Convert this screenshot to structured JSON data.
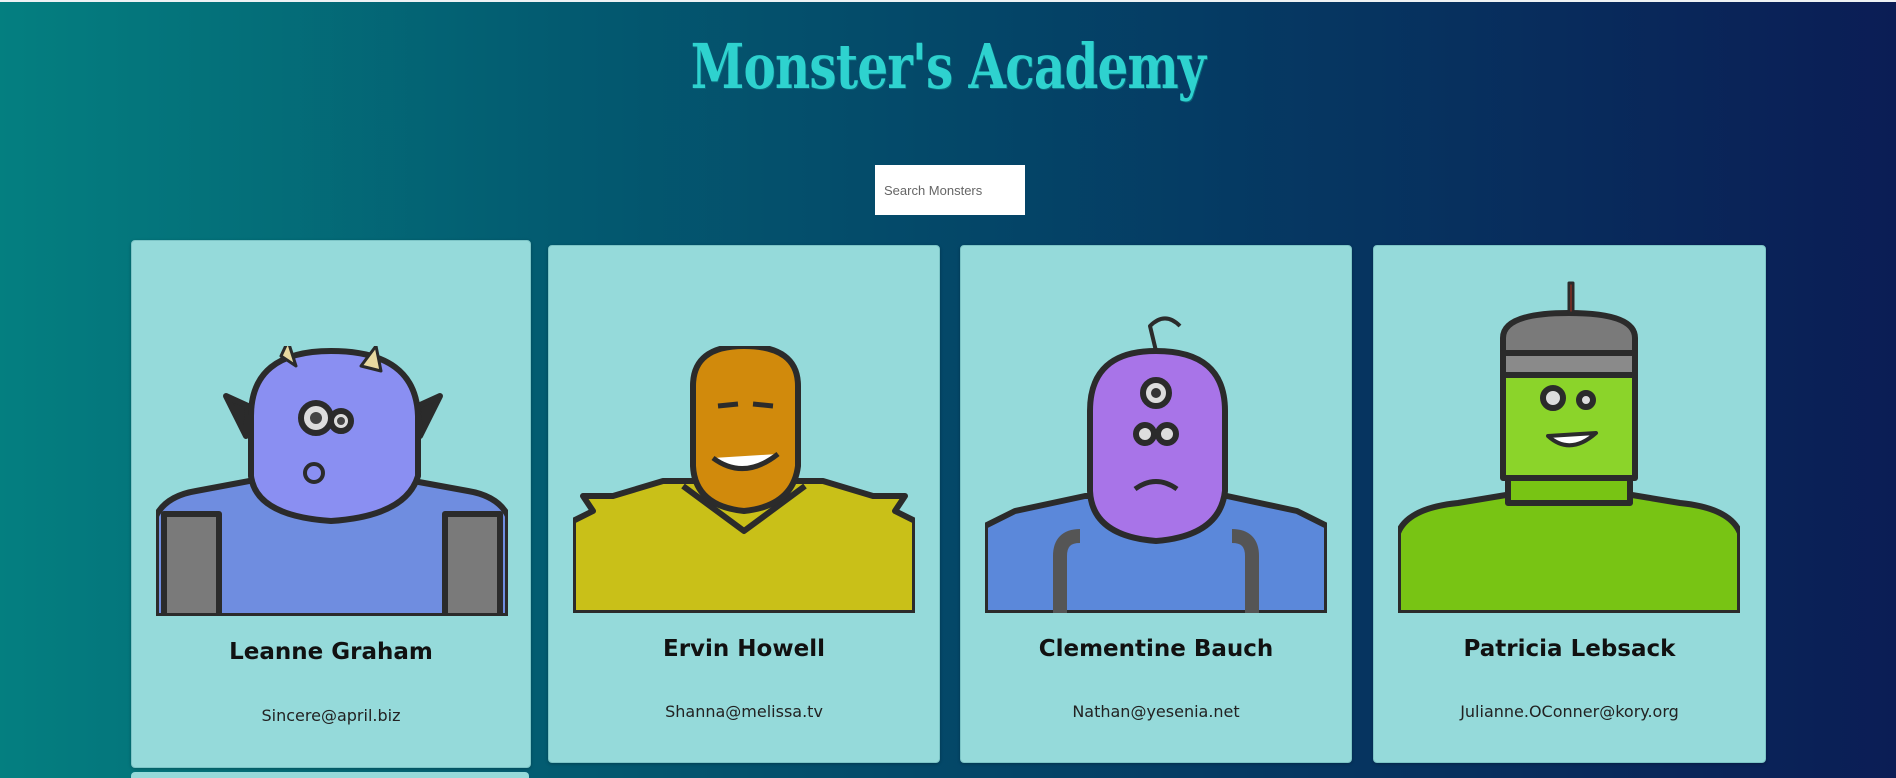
{
  "header": {
    "title": "Monster's Academy"
  },
  "search": {
    "placeholder": "Search Monsters",
    "value": ""
  },
  "monsters": [
    {
      "name": "Leanne Graham",
      "email": "Sincere@april.biz",
      "avatar": "blue-horned-monster-icon"
    },
    {
      "name": "Ervin Howell",
      "email": "Shanna@melissa.tv",
      "avatar": "orange-spiky-monster-icon"
    },
    {
      "name": "Clementine Bauch",
      "email": "Nathan@yesenia.net",
      "avatar": "purple-cyclops-monster-icon"
    },
    {
      "name": "Patricia Lebsack",
      "email": "Julianne.OConner@kory.org",
      "avatar": "green-robot-monster-icon"
    }
  ],
  "colors": {
    "background_start": "#047f80",
    "background_end": "#0b1d55",
    "title": "#2ed2cf",
    "card": "#95dada"
  }
}
